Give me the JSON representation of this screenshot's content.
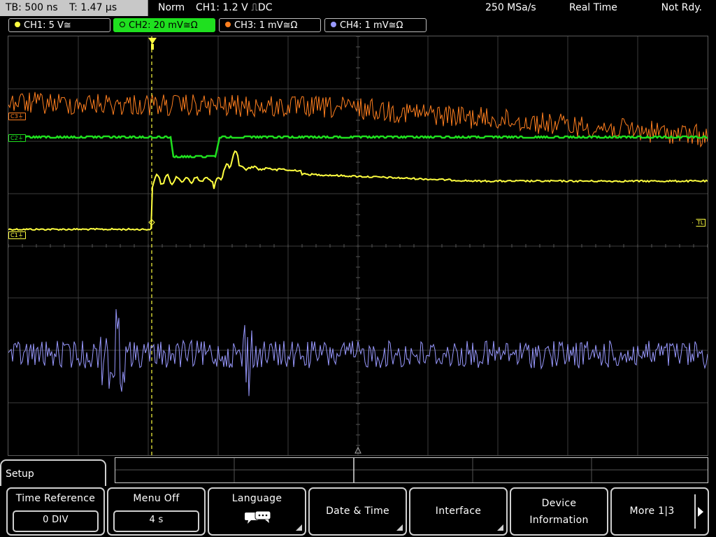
{
  "timebase": {
    "tb": "TB: 500 ns",
    "t": "T: 1.47 µs"
  },
  "status": {
    "mode": "Norm",
    "trigger": "CH1: 1.2 V ⎍DC",
    "sample_rate": "250 MSa/s",
    "acquisition": "Real Time",
    "state": "Not Rdy."
  },
  "channels": [
    {
      "label": "CH1: 5 V≅",
      "color": "#ffff40",
      "active": false
    },
    {
      "label": "CH2: 20 mV≅Ω",
      "color": "#1fe01f",
      "active": true
    },
    {
      "label": "CH3: 1 mV≅Ω",
      "color": "#ff7f1f",
      "active": false
    },
    {
      "label": "CH4: 1 mV≅Ω",
      "color": "#9999ff",
      "active": false
    }
  ],
  "markers": {
    "c1": "C1⏚",
    "c2": "C2⏚",
    "c3": "C3⏚",
    "trigger_level": "TL"
  },
  "menu": {
    "title": "Setup",
    "time_reference": {
      "label": "Time Reference",
      "value": "0 DIV"
    },
    "menu_off": {
      "label": "Menu Off",
      "value": "4 s"
    },
    "language": {
      "label": "Language"
    },
    "date_time": {
      "label": "Date & Time"
    },
    "interface": {
      "label": "Interface"
    },
    "device_information": {
      "label_line1": "Device",
      "label_line2": "Information"
    },
    "more": {
      "label": "More 1|3"
    }
  },
  "colors": {
    "ch1": "#ffff40",
    "ch2": "#1fe01f",
    "ch3": "#ff7f1f",
    "ch4": "#9999ff",
    "grid": "#3c3c3c"
  }
}
